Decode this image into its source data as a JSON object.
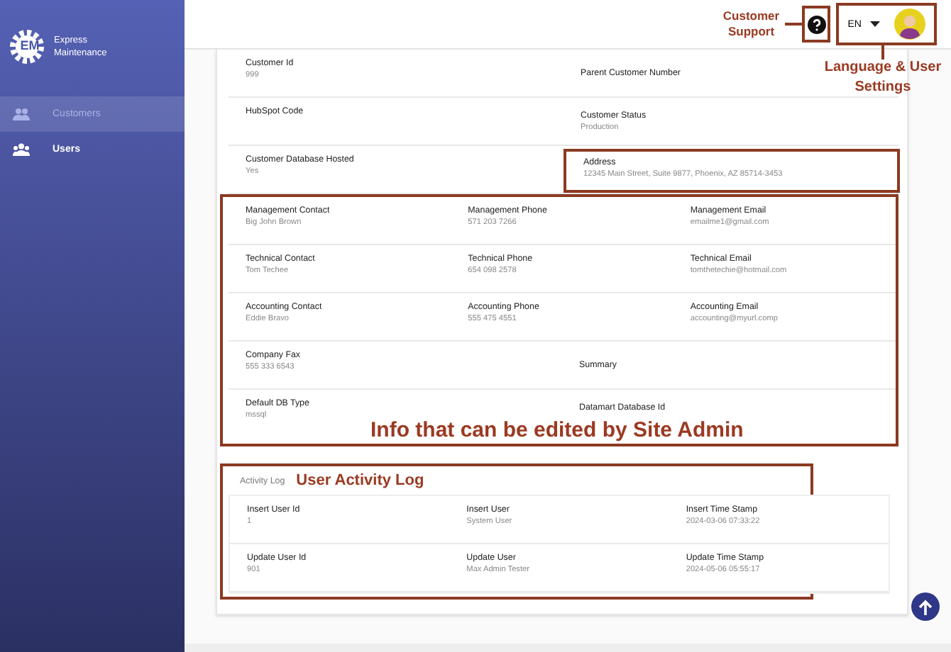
{
  "brand": {
    "name": "Express",
    "sub": "Maintenance",
    "logo": "EM"
  },
  "nav": [
    {
      "label": "Customers",
      "selected": true
    },
    {
      "label": "Users",
      "selected": false
    }
  ],
  "header": {
    "support_note": "Customer Support",
    "language": "EN",
    "settings_note": "Language & User Settings"
  },
  "details": {
    "rows": [
      [
        {
          "label": "Customer Id",
          "value": "999"
        },
        {
          "label": "Parent Customer Number"
        }
      ],
      [
        {
          "label": "HubSpot Code"
        },
        {
          "label": "Customer Status",
          "value": "Production"
        }
      ],
      [
        {
          "label": "Customer Database Hosted",
          "value": "Yes"
        },
        {
          "label": "Address",
          "value": "12345 Main Street, Suite 9877, Phoenix, AZ 85714-3453",
          "highlighted": true
        }
      ]
    ]
  },
  "editable": {
    "note": "Info that can be edited by Site Admin",
    "rows": [
      [
        {
          "label": "Management Contact",
          "value": "Big John Brown"
        },
        {
          "label": "Management Phone",
          "value": "571 203 7266"
        },
        {
          "label": "Management Email",
          "value": "emailme1@gmail.com"
        }
      ],
      [
        {
          "label": "Technical Contact",
          "value": "Tom Techee"
        },
        {
          "label": "Technical Phone",
          "value": "654 098 2578"
        },
        {
          "label": "Technical Email",
          "value": "tomthetechie@hotmail.com"
        }
      ],
      [
        {
          "label": "Accounting Contact",
          "value": "Eddie Bravo"
        },
        {
          "label": "Accounting Phone",
          "value": "555 475 4551"
        },
        {
          "label": "Accounting Email",
          "value": "accounting@myurl.comp"
        }
      ],
      [
        {
          "label": "Company Fax",
          "value": "555 333 6543"
        },
        {
          "label": "Summary"
        }
      ],
      [
        {
          "label": "Default DB Type",
          "value": "mssql"
        },
        {
          "label": "Datamart Database Id"
        }
      ]
    ]
  },
  "activity": {
    "title": "Activity Log",
    "note": "User Activity Log",
    "rows": [
      [
        {
          "label": "Insert User Id",
          "value": "1"
        },
        {
          "label": "Insert User",
          "value": "System User"
        },
        {
          "label": "Insert Time Stamp",
          "value": "2024-03-06 07:33:22"
        }
      ],
      [
        {
          "label": "Update User Id",
          "value": "901"
        },
        {
          "label": "Update User",
          "value": "Max Admin Tester"
        },
        {
          "label": "Update Time Stamp",
          "value": "2024-05-06 05:55:17"
        }
      ]
    ]
  }
}
